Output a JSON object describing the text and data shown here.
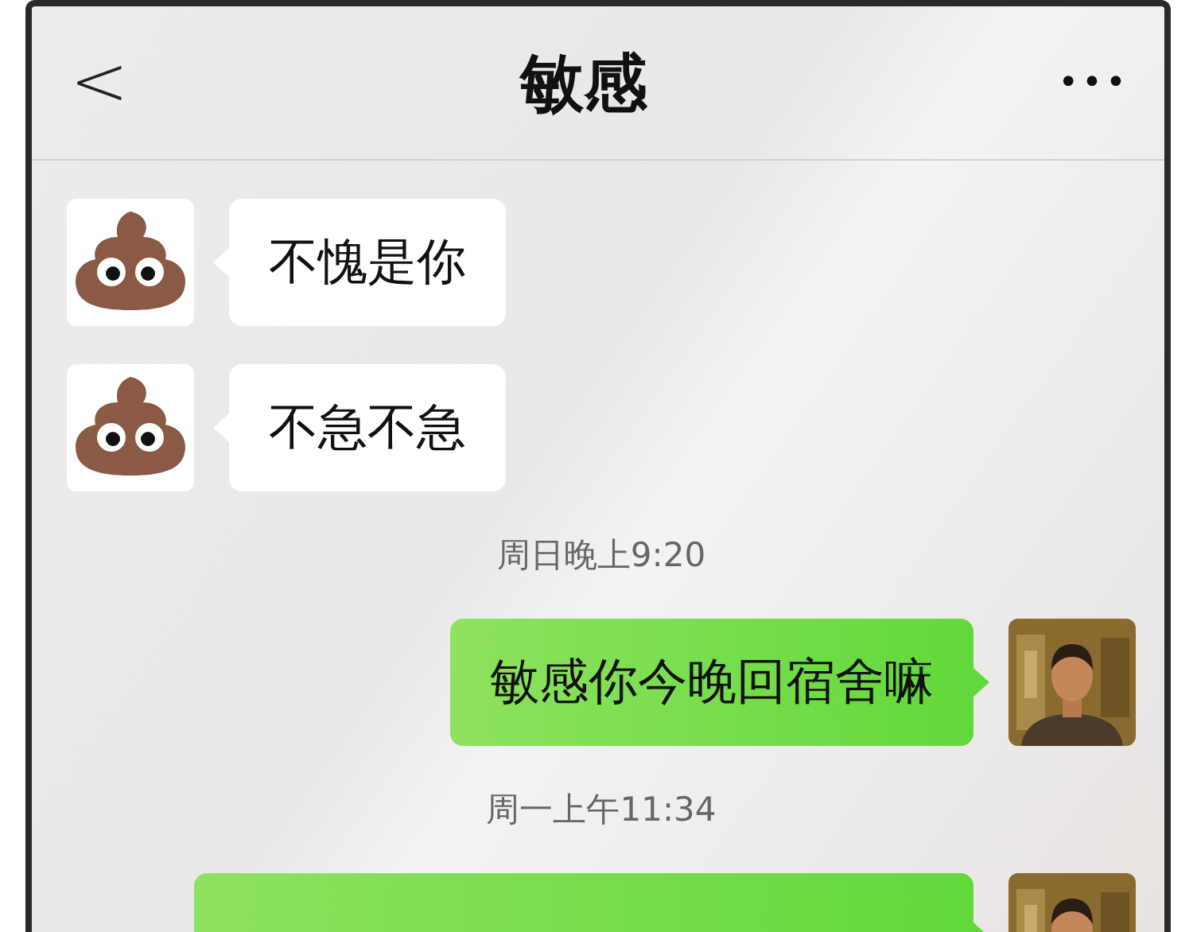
{
  "header": {
    "back": "<",
    "title": "敏感",
    "more": "•••"
  },
  "messages": [
    {
      "kind": "incoming",
      "text": "不愧是你"
    },
    {
      "kind": "incoming",
      "text": "不急不急"
    },
    {
      "kind": "time",
      "text": "周日晚上9:20"
    },
    {
      "kind": "outgoing",
      "text": "敏感你今晚回宿舍嘛"
    },
    {
      "kind": "time",
      "text": "周一上午11:34"
    },
    {
      "kind": "outgoing"
    }
  ]
}
